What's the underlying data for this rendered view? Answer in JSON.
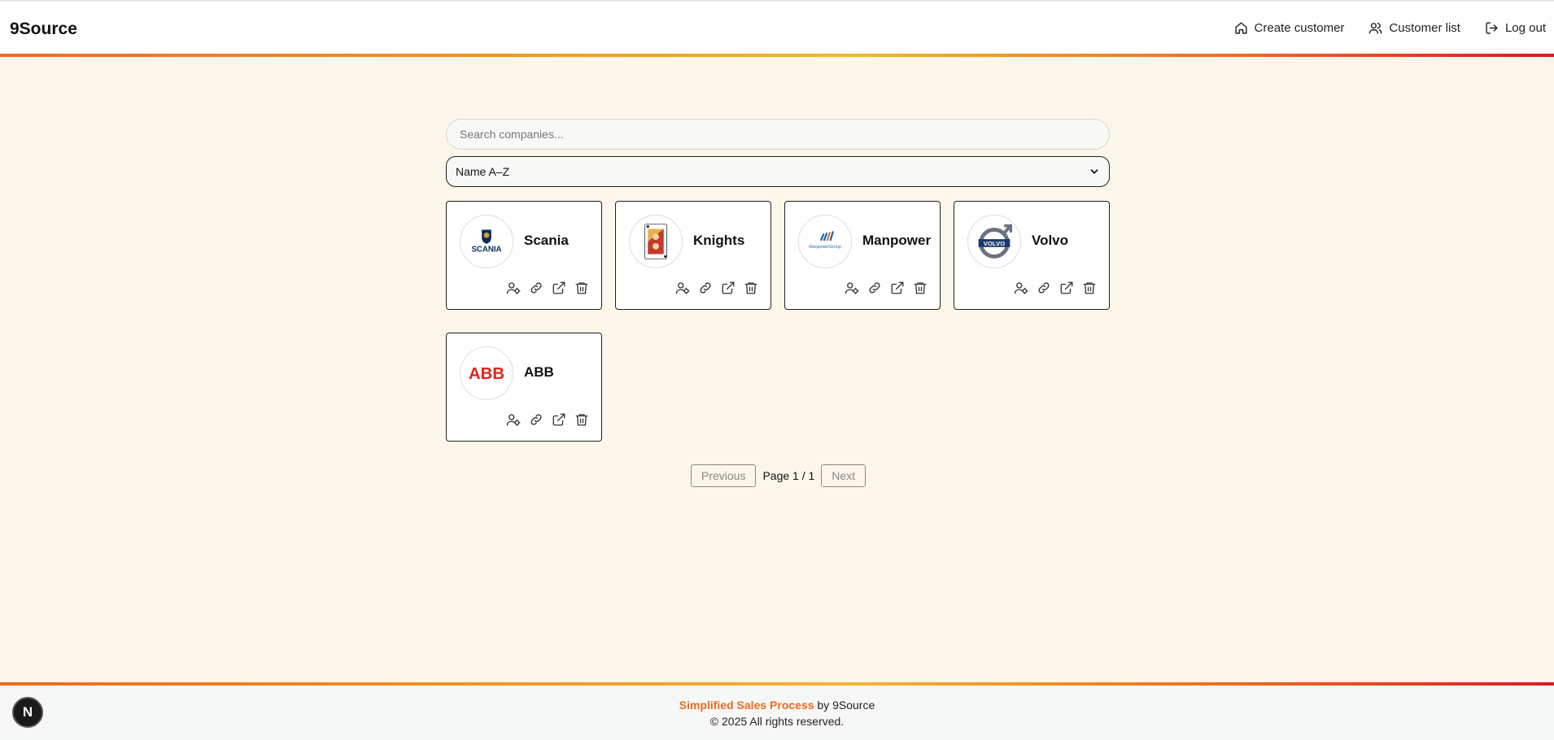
{
  "app": {
    "title": "9Source"
  },
  "nav": [
    {
      "label": "Create customer",
      "icon": "home-icon"
    },
    {
      "label": "Customer list",
      "icon": "users-icon"
    },
    {
      "label": "Log out",
      "icon": "logout-icon"
    }
  ],
  "search": {
    "placeholder": "Search companies...",
    "value": ""
  },
  "sort": {
    "selected": "Name A–Z"
  },
  "companies": [
    {
      "name": "Scania",
      "logo": "scania-logo"
    },
    {
      "name": "Knights",
      "logo": "playing-card-logo"
    },
    {
      "name": "Manpower",
      "logo": "manpowergroup-logo"
    },
    {
      "name": "Volvo",
      "logo": "volvo-logo"
    },
    {
      "name": "ABB",
      "logo": "abb-logo"
    }
  ],
  "logo_text": {
    "scania": "SCANIA",
    "manpower": "ManpowerGroup",
    "volvo": "VOLVO",
    "abb": "ABB"
  },
  "card_actions": [
    "add-contact-icon",
    "link-icon",
    "external-link-icon",
    "trash-icon"
  ],
  "pagination": {
    "previous": "Previous",
    "info": "Page 1 / 1",
    "next": "Next"
  },
  "footer": {
    "brand": "Simplified Sales Process",
    "by": " by 9Source",
    "copyright": "© 2025 All rights reserved."
  },
  "dev_badge": "N",
  "colors": {
    "accent": "#ee6a1e",
    "background": "#fdf6ea",
    "card_border": "#222222"
  }
}
